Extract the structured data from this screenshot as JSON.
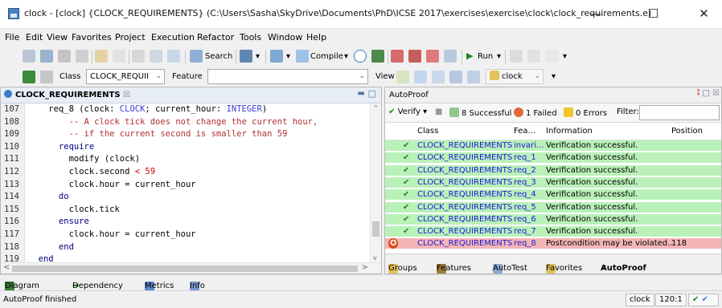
{
  "window": {
    "title": "clock - [clock] {CLOCK_REQUIREMENTS} (C:\\Users\\Sasha\\SkyDrive\\Documents\\PhD\\ICSE 2017\\exercises\\exercise\\clock\\clock_requirements.e)",
    "minimize": "—",
    "maximize": "☐",
    "close": "✕"
  },
  "menu": [
    "File",
    "Edit",
    "View",
    "Favorites",
    "Project",
    "Execution",
    "Refactor",
    "Tools",
    "Window",
    "Help"
  ],
  "toolbar": {
    "search_label": "Search",
    "compile_label": "Compile",
    "run_label": "Run"
  },
  "classbar": {
    "class_label": "Class",
    "class_value": "CLOCK_REQUII",
    "feature_label": "Feature",
    "feature_value": "",
    "view_label": "View",
    "clock_label": "clock"
  },
  "editor": {
    "tab_title": "CLOCK_REQUIREMENTS",
    "lines": [
      {
        "n": "107",
        "parts": [
          {
            "t": "    req_8 (clock: ",
            "c": ""
          },
          {
            "t": "CLOCK",
            "c": "cls"
          },
          {
            "t": "; current_hour: ",
            "c": ""
          },
          {
            "t": "INTEGER",
            "c": "cls"
          },
          {
            "t": ")",
            "c": ""
          }
        ]
      },
      {
        "n": "108",
        "parts": [
          {
            "t": "        -- A clock tick does not change the current hour,",
            "c": "cmt"
          }
        ]
      },
      {
        "n": "109",
        "parts": [
          {
            "t": "        -- if the current second is smaller than 59",
            "c": "cmt"
          }
        ]
      },
      {
        "n": "110",
        "parts": [
          {
            "t": "      require",
            "c": "kw"
          }
        ]
      },
      {
        "n": "111",
        "parts": [
          {
            "t": "        modify (clock)",
            "c": ""
          }
        ]
      },
      {
        "n": "112",
        "parts": [
          {
            "t": "        clock.second ",
            "c": ""
          },
          {
            "t": "<",
            "c": "op"
          },
          {
            "t": " ",
            "c": ""
          },
          {
            "t": "59",
            "c": "op"
          }
        ]
      },
      {
        "n": "113",
        "parts": [
          {
            "t": "        clock.hour = current_hour",
            "c": ""
          }
        ]
      },
      {
        "n": "114",
        "parts": [
          {
            "t": "      do",
            "c": "kw"
          }
        ]
      },
      {
        "n": "115",
        "parts": [
          {
            "t": "        clock.tick",
            "c": ""
          }
        ]
      },
      {
        "n": "116",
        "parts": [
          {
            "t": "      ensure",
            "c": "kw"
          }
        ]
      },
      {
        "n": "117",
        "parts": [
          {
            "t": "        clock.hour = current_hour",
            "c": ""
          }
        ]
      },
      {
        "n": "118",
        "parts": [
          {
            "t": "      end",
            "c": "kw"
          }
        ]
      },
      {
        "n": "119",
        "parts": [
          {
            "t": "  end",
            "c": "kw"
          }
        ]
      }
    ]
  },
  "autoproof": {
    "title": "AutoProof",
    "verify_label": "Verify",
    "successful": "8 Successful",
    "failed": "1 Failed",
    "errors": "0 Errors",
    "filter_label": "Filter:",
    "filter_value": "",
    "columns": {
      "class": "Class",
      "feature": "Fea...",
      "information": "Information",
      "position": "Position"
    },
    "rows": [
      {
        "status": "ok",
        "class": "CLOCK_REQUIREMENTS",
        "feature": "invari...",
        "info": "Verification successful.",
        "position": ""
      },
      {
        "status": "ok",
        "class": "CLOCK_REQUIREMENTS",
        "feature": "req_1",
        "info": "Verification successful.",
        "position": ""
      },
      {
        "status": "ok",
        "class": "CLOCK_REQUIREMENTS",
        "feature": "req_2",
        "info": "Verification successful.",
        "position": ""
      },
      {
        "status": "ok",
        "class": "CLOCK_REQUIREMENTS",
        "feature": "req_3",
        "info": "Verification successful.",
        "position": ""
      },
      {
        "status": "ok",
        "class": "CLOCK_REQUIREMENTS",
        "feature": "req_4",
        "info": "Verification successful.",
        "position": ""
      },
      {
        "status": "ok",
        "class": "CLOCK_REQUIREMENTS",
        "feature": "req_5",
        "info": "Verification successful.",
        "position": ""
      },
      {
        "status": "ok",
        "class": "CLOCK_REQUIREMENTS",
        "feature": "req_6",
        "info": "Verification successful.",
        "position": ""
      },
      {
        "status": "ok",
        "class": "CLOCK_REQUIREMENTS",
        "feature": "req_7",
        "info": "Verification successful.",
        "position": ""
      },
      {
        "status": "fail",
        "class": "CLOCK_REQUIREMENTS",
        "feature": "req_8",
        "info": "Postcondition may be violated...",
        "position": "118"
      }
    ],
    "tabs": [
      "Groups",
      "Features",
      "AutoTest",
      "Favorites",
      "AutoProof"
    ]
  },
  "tools": [
    "Diagram",
    "Dependency",
    "Metrics",
    "Info"
  ],
  "status": {
    "message": "AutoProof finished",
    "context": "clock",
    "position": "120:1"
  }
}
